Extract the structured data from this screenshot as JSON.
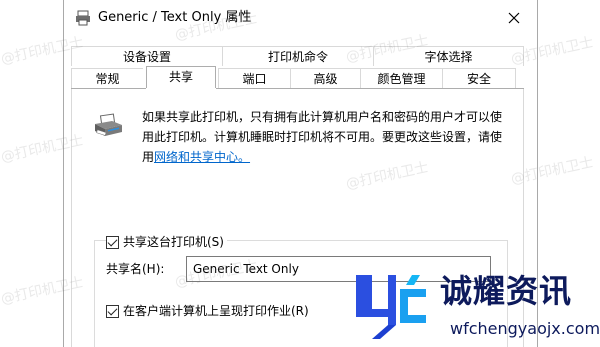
{
  "window": {
    "title": "Generic / Text Only 属性"
  },
  "tabs": {
    "row1": [
      {
        "label": "设备设置"
      },
      {
        "label": "打印机命令"
      },
      {
        "label": "字体选择"
      }
    ],
    "row2": [
      {
        "label": "常规"
      },
      {
        "label": "共享"
      },
      {
        "label": "端口"
      },
      {
        "label": "高级"
      },
      {
        "label": "颜色管理"
      },
      {
        "label": "安全"
      }
    ],
    "selected": "共享"
  },
  "sharing": {
    "desc_line1": "如果共享此打印机，只有拥有此计算机用户名和密码的用户才可以使",
    "desc_line2": "用此打印机。计算机睡眠时打印机将不可用。要更改这些设置，请使",
    "desc_line3_prefix": "用",
    "desc_link": "网络和共享中心。",
    "share_checkbox_label": "共享这台打印机(S)",
    "share_checked": true,
    "share_name_label": "共享名(H):",
    "share_name_value": "Generic  Text Only",
    "render_jobs_label": "在客户端计算机上呈现打印作业(R)",
    "render_jobs_checked": true
  },
  "watermark": {
    "text": "@打印机卫士"
  },
  "brand": {
    "name": "诚耀资讯",
    "url": "wfchengyaojx.com"
  },
  "icons": {
    "title": "printer-icon",
    "close": "close-icon",
    "share": "printer-icon"
  }
}
